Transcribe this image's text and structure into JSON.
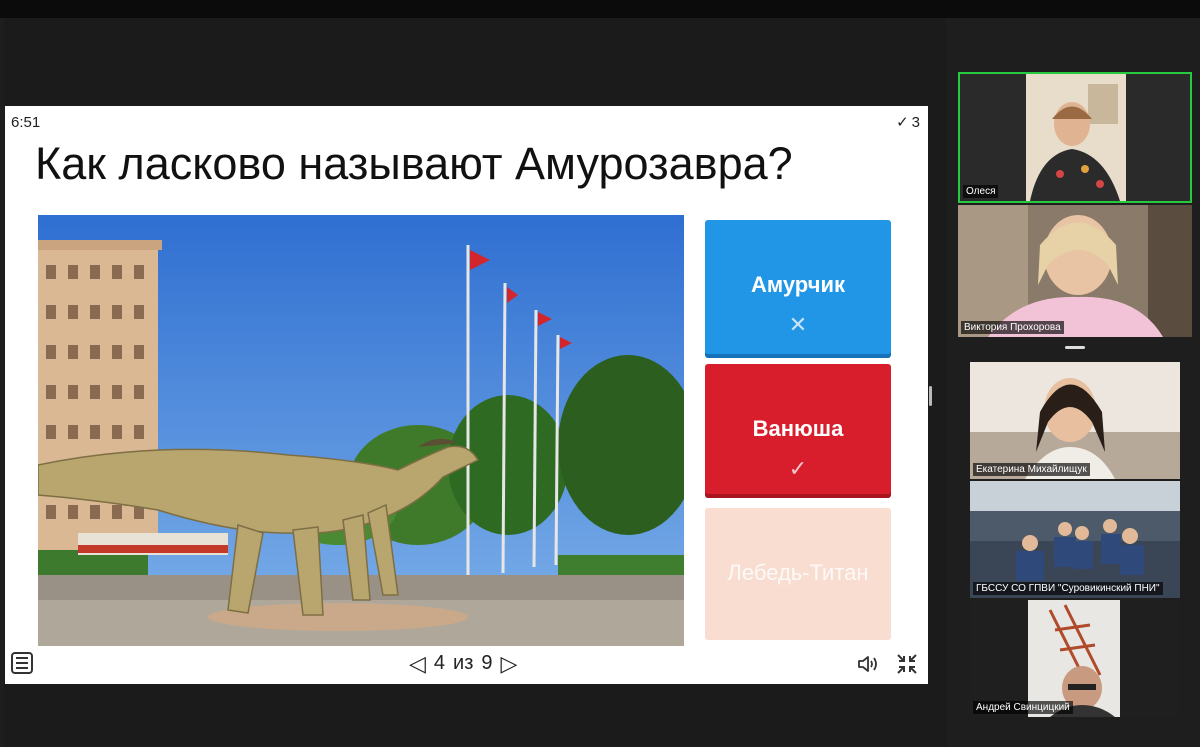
{
  "slide": {
    "timer": "6:51",
    "score": "3",
    "question": "Как ласково называют Амурозавра?",
    "answers": [
      {
        "label": "Амурчик",
        "mark": "✕"
      },
      {
        "label": "Ванюша",
        "mark": "✓"
      },
      {
        "label": "Лебедь-Титан",
        "mark": ""
      }
    ],
    "pager": {
      "current": "4",
      "sep": "из",
      "total": "9",
      "prev": "◁",
      "next": "▷"
    }
  },
  "participants": [
    {
      "name": "Олеся"
    },
    {
      "name": "Виктория Прохорова"
    },
    {
      "name": "Екатерина Михайлищук"
    },
    {
      "name": "ГБССУ СО ГПВИ \"Суровикинский ПНИ\""
    },
    {
      "name": "Андрей Свинцицкий"
    }
  ],
  "colors": {
    "correct": "#d81e2c",
    "wrong": "#2196e6",
    "inactive": "#f8ddd0",
    "active_speaker": "#27c93f"
  }
}
